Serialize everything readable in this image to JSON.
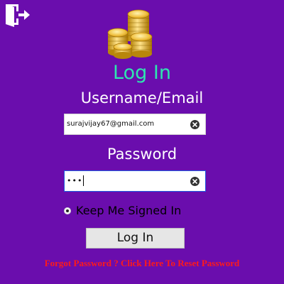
{
  "header": {
    "exit_icon": "exit-door-icon",
    "logo_icon": "gold-coins-icon"
  },
  "login": {
    "title": "Log In",
    "username_label": "Username/Email",
    "username_value": "surajvijay67@gmail.com",
    "password_label": "Password",
    "password_value": "•••",
    "keep_signed_in_label": "Keep Me Signed In",
    "keep_signed_in_checked": true,
    "login_button_label": "Log In",
    "forgot_password_link": "Forgot Password ? Click Here To Reset Password"
  },
  "colors": {
    "background": "#6a0dad",
    "title": "#2ee6b0",
    "link": "#ff1a1a",
    "focus_border": "#1e5be0"
  }
}
